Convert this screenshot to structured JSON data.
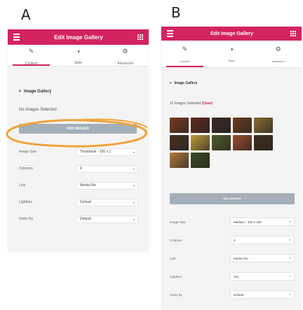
{
  "labels": {
    "a": "A",
    "b": "B"
  },
  "panel_a": {
    "header_title": "Edit Image Gallery",
    "tabs": [
      {
        "label": "Content",
        "icon": "pencil-icon"
      },
      {
        "label": "Style",
        "icon": "half-circle-icon"
      },
      {
        "label": "Advanced",
        "icon": "gear-icon"
      }
    ],
    "section_title": "Image Gallery",
    "status": "No images Selected",
    "add_label": "ADD IMAGES",
    "fields": [
      {
        "label": "Image Size",
        "value": "Thumbnail - 150 x 1"
      },
      {
        "label": "Columns",
        "value": "4"
      },
      {
        "label": "Link",
        "value": "Media File"
      },
      {
        "label": "Lightbox",
        "value": "Default"
      },
      {
        "label": "Order By",
        "value": "Default"
      }
    ]
  },
  "panel_b": {
    "header_title": "Edit Image Gallery",
    "tabs": [
      {
        "label": "Content",
        "icon": "pencil-icon"
      },
      {
        "label": "Style",
        "icon": "half-circle-icon"
      },
      {
        "label": "Advanced",
        "icon": "gear-icon"
      }
    ],
    "section_title": "Image Gallery",
    "status": "12 Images Selected",
    "clear_label": "(Clear)",
    "add_label": "ADD IMAGES",
    "fields": [
      {
        "label": "Image Size",
        "value": "Medium - 300 x 300"
      },
      {
        "label": "Columns",
        "value": "4"
      },
      {
        "label": "Link",
        "value": "Media File"
      },
      {
        "label": "Lightbox",
        "value": "Yes"
      },
      {
        "label": "Order By",
        "value": "Default"
      }
    ],
    "thumb_colors": [
      "#7a3b22",
      "#5c2a1e",
      "#3a2a22",
      "#6b3d1f",
      "#8a6a2c",
      "#4a3020",
      "#c09a3a",
      "#4f5a2a",
      "#9a4a2a",
      "#3f2f1a",
      "#b07a3a",
      "#3a4a22"
    ]
  },
  "colors": {
    "accent": "#d3245e",
    "button": "#a4afb7",
    "highlight": "#f0a23a"
  }
}
